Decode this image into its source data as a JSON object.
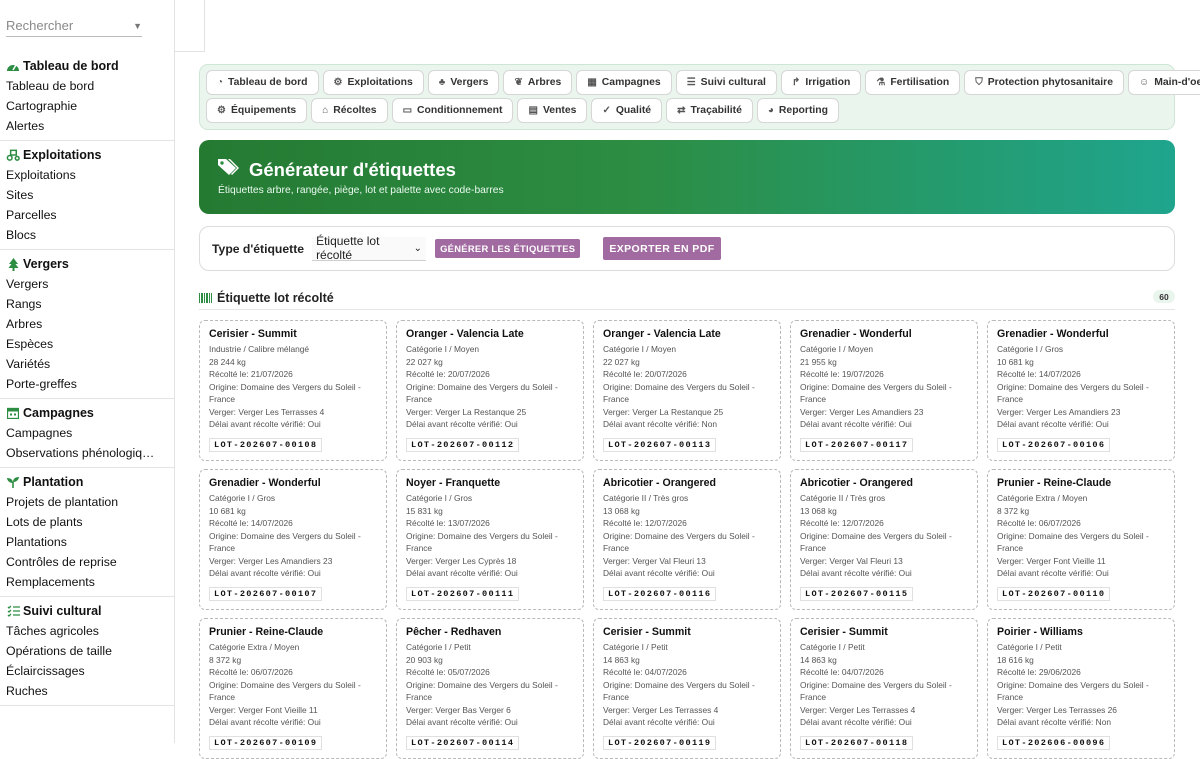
{
  "search": {
    "placeholder": "Rechercher"
  },
  "sidebar": {
    "sections": [
      {
        "title": "Tableau de bord",
        "icon": "gauge-icon",
        "items": [
          "Tableau de bord",
          "Cartographie",
          "Alertes"
        ]
      },
      {
        "title": "Exploitations",
        "icon": "tractor-icon",
        "items": [
          "Exploitations",
          "Sites",
          "Parcelles",
          "Blocs"
        ]
      },
      {
        "title": "Vergers",
        "icon": "tree-icon",
        "items": [
          "Vergers",
          "Rangs",
          "Arbres",
          "Espèces",
          "Variétés",
          "Porte-greffes"
        ]
      },
      {
        "title": "Campagnes",
        "icon": "calendar-icon",
        "items": [
          "Campagnes",
          "Observations phénologiq…"
        ]
      },
      {
        "title": "Plantation",
        "icon": "seedling-icon",
        "items": [
          "Projets de plantation",
          "Lots de plants",
          "Plantations",
          "Contrôles de reprise",
          "Remplacements"
        ]
      },
      {
        "title": "Suivi cultural",
        "icon": "checklist-icon",
        "items": [
          "Tâches agricoles",
          "Opérations de taille",
          "Éclaircissages",
          "Ruches"
        ]
      }
    ]
  },
  "tabs": {
    "row1": [
      {
        "label": "Tableau de bord",
        "icon": "gauge-icon",
        "glyph": "◔"
      },
      {
        "label": "Exploitations",
        "icon": "tractor-icon",
        "glyph": "⚙"
      },
      {
        "label": "Vergers",
        "icon": "tree-icon",
        "glyph": "♣"
      },
      {
        "label": "Arbres",
        "icon": "leaf-icon",
        "glyph": "❦"
      },
      {
        "label": "Campagnes",
        "icon": "calendar-icon",
        "glyph": "▦"
      },
      {
        "label": "Suivi cultural",
        "icon": "checklist-icon",
        "glyph": "☰"
      },
      {
        "label": "Irrigation",
        "icon": "faucet-icon",
        "glyph": "↱"
      },
      {
        "label": "Fertilisation",
        "icon": "flask-icon",
        "glyph": "⚗"
      },
      {
        "label": "Protection phytosanitaire",
        "icon": "shield-icon",
        "glyph": "⛉"
      },
      {
        "label": "Main-d'oeuvre",
        "icon": "users-icon",
        "glyph": "☺"
      }
    ],
    "row2": [
      {
        "label": "Équipements",
        "icon": "tractor-icon",
        "glyph": "⚙"
      },
      {
        "label": "Récoltes",
        "icon": "basket-icon",
        "glyph": "⌂"
      },
      {
        "label": "Conditionnement",
        "icon": "box-icon",
        "glyph": "▭"
      },
      {
        "label": "Ventes",
        "icon": "receipt-icon",
        "glyph": "▤"
      },
      {
        "label": "Qualité",
        "icon": "check-icon",
        "glyph": "✓"
      },
      {
        "label": "Traçabilité",
        "icon": "route-icon",
        "glyph": "⇄"
      },
      {
        "label": "Reporting",
        "icon": "pie-chart-icon",
        "glyph": "◕"
      }
    ]
  },
  "banner": {
    "title": "Générateur d'étiquettes",
    "subtitle": "Étiquettes arbre, rangée, piège, lot et palette avec code-barres",
    "icon": "tags-icon"
  },
  "controls": {
    "type_label": "Type d'étiquette",
    "type_value": "Étiquette lot récolté",
    "generate_label": "GÉNÉRER LES ÉTIQUETTES",
    "export_label": "EXPORTER EN PDF",
    "accent": "#a16aa0"
  },
  "section": {
    "title": "Étiquette lot récolté",
    "count": "60",
    "icon": "barcode-icon"
  },
  "labels": [
    {
      "title": "Cerisier - Summit",
      "category": "Industrie / Calibre mélangé",
      "weight": "28 244 kg",
      "harvested": "Récolté le: 21/07/2026",
      "origin": "Origine: Domaine des Vergers du Soleil - France",
      "orchard": "Verger: Verger Les Terrasses 4",
      "delay": "Délai avant récolte vérifié: Oui",
      "code": "LOT-202607-00108"
    },
    {
      "title": "Oranger - Valencia Late",
      "category": "Catégorie I / Moyen",
      "weight": "22 027 kg",
      "harvested": "Récolté le: 20/07/2026",
      "origin": "Origine: Domaine des Vergers du Soleil - France",
      "orchard": "Verger: Verger La Restanque 25",
      "delay": "Délai avant récolte vérifié: Oui",
      "code": "LOT-202607-00112"
    },
    {
      "title": "Oranger - Valencia Late",
      "category": "Catégorie I / Moyen",
      "weight": "22 027 kg",
      "harvested": "Récolté le: 20/07/2026",
      "origin": "Origine: Domaine des Vergers du Soleil - France",
      "orchard": "Verger: Verger La Restanque 25",
      "delay": "Délai avant récolte vérifié: Non",
      "code": "LOT-202607-00113"
    },
    {
      "title": "Grenadier - Wonderful",
      "category": "Catégorie I / Moyen",
      "weight": "21 955 kg",
      "harvested": "Récolté le: 19/07/2026",
      "origin": "Origine: Domaine des Vergers du Soleil - France",
      "orchard": "Verger: Verger Les Amandiers 23",
      "delay": "Délai avant récolte vérifié: Oui",
      "code": "LOT-202607-00117"
    },
    {
      "title": "Grenadier - Wonderful",
      "category": "Catégorie I / Gros",
      "weight": "10 681 kg",
      "harvested": "Récolté le: 14/07/2026",
      "origin": "Origine: Domaine des Vergers du Soleil - France",
      "orchard": "Verger: Verger Les Amandiers 23",
      "delay": "Délai avant récolte vérifié: Oui",
      "code": "LOT-202607-00106"
    },
    {
      "title": "Grenadier - Wonderful",
      "category": "Catégorie I / Gros",
      "weight": "10 681 kg",
      "harvested": "Récolté le: 14/07/2026",
      "origin": "Origine: Domaine des Vergers du Soleil - France",
      "orchard": "Verger: Verger Les Amandiers 23",
      "delay": "Délai avant récolte vérifié: Oui",
      "code": "LOT-202607-00107"
    },
    {
      "title": "Noyer - Franquette",
      "category": "Catégorie I / Gros",
      "weight": "15 831 kg",
      "harvested": "Récolté le: 13/07/2026",
      "origin": "Origine: Domaine des Vergers du Soleil - France",
      "orchard": "Verger: Verger Les Cyprès 18",
      "delay": "Délai avant récolte vérifié: Oui",
      "code": "LOT-202607-00111"
    },
    {
      "title": "Abricotier - Orangered",
      "category": "Catégorie II / Très gros",
      "weight": "13 068 kg",
      "harvested": "Récolté le: 12/07/2026",
      "origin": "Origine: Domaine des Vergers du Soleil - France",
      "orchard": "Verger: Verger Val Fleuri 13",
      "delay": "Délai avant récolte vérifié: Oui",
      "code": "LOT-202607-00116"
    },
    {
      "title": "Abricotier - Orangered",
      "category": "Catégorie II / Très gros",
      "weight": "13 068 kg",
      "harvested": "Récolté le: 12/07/2026",
      "origin": "Origine: Domaine des Vergers du Soleil - France",
      "orchard": "Verger: Verger Val Fleuri 13",
      "delay": "Délai avant récolte vérifié: Oui",
      "code": "LOT-202607-00115"
    },
    {
      "title": "Prunier - Reine-Claude",
      "category": "Catégorie Extra / Moyen",
      "weight": "8 372 kg",
      "harvested": "Récolté le: 06/07/2026",
      "origin": "Origine: Domaine des Vergers du Soleil - France",
      "orchard": "Verger: Verger Font Vieille 11",
      "delay": "Délai avant récolte vérifié: Oui",
      "code": "LOT-202607-00110"
    },
    {
      "title": "Prunier - Reine-Claude",
      "category": "Catégorie Extra / Moyen",
      "weight": "8 372 kg",
      "harvested": "Récolté le: 06/07/2026",
      "origin": "Origine: Domaine des Vergers du Soleil - France",
      "orchard": "Verger: Verger Font Vieille 11",
      "delay": "Délai avant récolte vérifié: Oui",
      "code": "LOT-202607-00109"
    },
    {
      "title": "Pêcher - Redhaven",
      "category": "Catégorie I / Petit",
      "weight": "20 903 kg",
      "harvested": "Récolté le: 05/07/2026",
      "origin": "Origine: Domaine des Vergers du Soleil - France",
      "orchard": "Verger: Verger Bas Verger 6",
      "delay": "Délai avant récolte vérifié: Oui",
      "code": "LOT-202607-00114"
    },
    {
      "title": "Cerisier - Summit",
      "category": "Catégorie I / Petit",
      "weight": "14 863 kg",
      "harvested": "Récolté le: 04/07/2026",
      "origin": "Origine: Domaine des Vergers du Soleil - France",
      "orchard": "Verger: Verger Les Terrasses 4",
      "delay": "Délai avant récolte vérifié: Oui",
      "code": "LOT-202607-00119"
    },
    {
      "title": "Cerisier - Summit",
      "category": "Catégorie I / Petit",
      "weight": "14 863 kg",
      "harvested": "Récolté le: 04/07/2026",
      "origin": "Origine: Domaine des Vergers du Soleil - France",
      "orchard": "Verger: Verger Les Terrasses 4",
      "delay": "Délai avant récolte vérifié: Oui",
      "code": "LOT-202607-00118"
    },
    {
      "title": "Poirier - Williams",
      "category": "Catégorie I / Petit",
      "weight": "18 616 kg",
      "harvested": "Récolté le: 29/06/2026",
      "origin": "Origine: Domaine des Vergers du Soleil - France",
      "orchard": "Verger: Verger Les Terrasses 26",
      "delay": "Délai avant récolte vérifié: Non",
      "code": "LOT-202606-00096"
    }
  ]
}
